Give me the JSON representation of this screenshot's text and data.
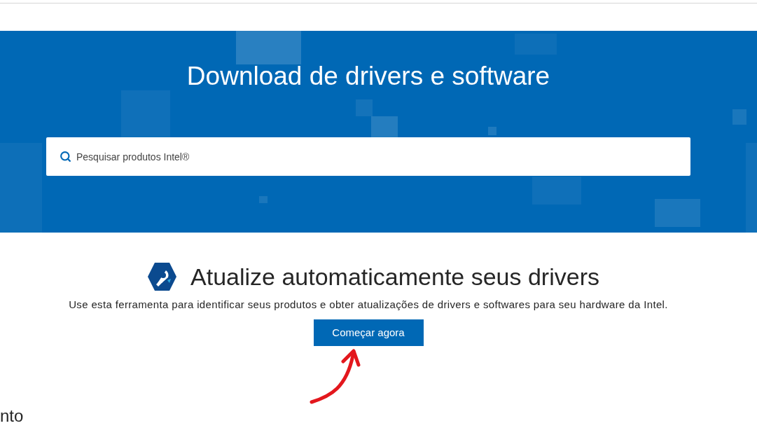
{
  "banner": {
    "title": "Download de drivers e software",
    "search": {
      "placeholder": "Pesquisar produtos Intel®"
    }
  },
  "auto_update": {
    "title": "Atualize automaticamente seus drivers",
    "description": "Use esta ferramenta para identificar seus produtos e obter atualizações de drivers e softwares para seu hardware da Intel.",
    "button": "Começar agora"
  },
  "next_section": {
    "heading": "nto"
  }
}
